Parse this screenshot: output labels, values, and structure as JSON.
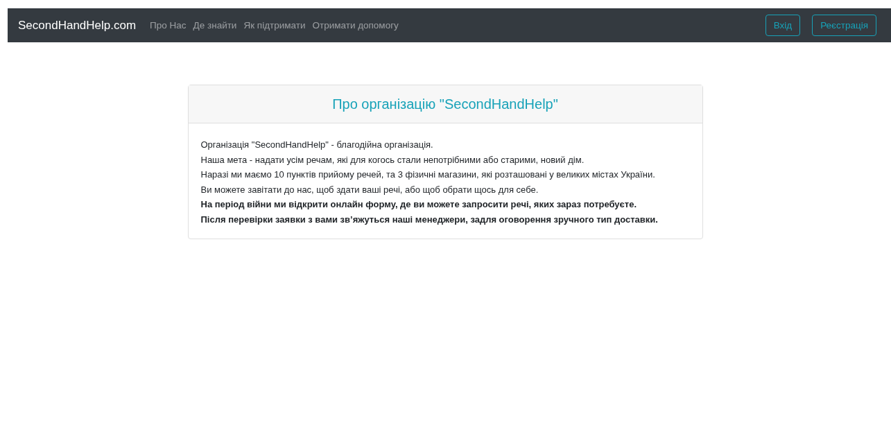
{
  "navbar": {
    "brand": "SecondHandHelp.com",
    "links": [
      {
        "label": "Про Нас"
      },
      {
        "label": "Де знайти"
      },
      {
        "label": "Як підтримати"
      },
      {
        "label": "Отримати допомогу"
      }
    ],
    "buttons": [
      {
        "label": "Вхід"
      },
      {
        "label": "Реєстрація"
      }
    ]
  },
  "card": {
    "title": "Про організацію \"SecondHandHelp\"",
    "lines": [
      {
        "text": "Організація \"SecondHandHelp\" - благодійна організація.",
        "bold": false
      },
      {
        "text": "Наша мета - надати усім речам, які для когось стали непотрібними або старими, новий дім.",
        "bold": false
      },
      {
        "text": "Наразі ми маємо 10 пунктів прийому речей, та 3 фізичні магазини, які розташовані у великих містах України.",
        "bold": false
      },
      {
        "text": "Ви можете завітати до нас, щоб здати ваші речі, або щоб обрати щось для себе.",
        "bold": false
      },
      {
        "text": "На період війни ми відкрити онлайн форму, де ви можете запросити речі, яких зараз потребуєте.",
        "bold": true
      },
      {
        "text": "Після перевірки заявки з вами зв’яжуться наші менеджери, задля оговорення зручного тип доставки.",
        "bold": true
      }
    ]
  }
}
